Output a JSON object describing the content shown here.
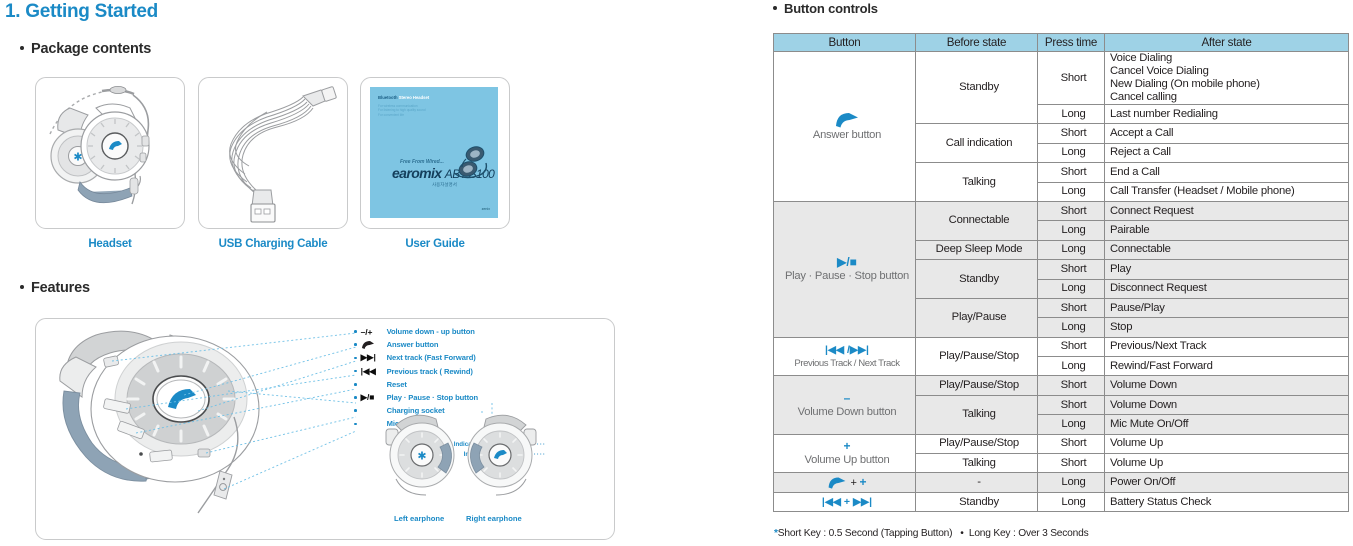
{
  "headings": {
    "chapter": "1. Getting Started",
    "package_contents": "Package contents",
    "features": "Features",
    "button_controls": "Button controls"
  },
  "package": {
    "items": [
      {
        "label": "Headset",
        "image": "headset-illustration"
      },
      {
        "label": "USB Charging Cable",
        "image": "usb-cable-illustration"
      },
      {
        "label": "User Guide",
        "image": "user-guide-cover"
      }
    ],
    "guide_cover": {
      "brand_prefix": "Bluetooth",
      "brand": "Stereo Headset",
      "lines": [
        "For wireless communication",
        "For listening to high quality sound",
        "For convenient life"
      ],
      "tagline": "Free From Wired...",
      "title": "earomix",
      "model": "ABT-S100",
      "subtitle": "사용자설명서",
      "logo": "zenix"
    }
  },
  "features": {
    "callouts": [
      {
        "symbol": "–/+",
        "label": "Volume down - up button"
      },
      {
        "symbol": "phone-icon",
        "label": "Answer button"
      },
      {
        "symbol": "▶▶|",
        "label": "Next track (Fast Forward)"
      },
      {
        "symbol": "|◀◀",
        "label": "Previous track ( Rewind)"
      },
      {
        "symbol": "",
        "label": "Reset"
      },
      {
        "symbol": "▶/■",
        "label": "Play · Pause · Stop button"
      },
      {
        "symbol": "",
        "label": "Charging socket"
      },
      {
        "symbol": "",
        "label": "Microphone"
      }
    ],
    "indicators": [
      "Indicator Lights (BLUE)",
      "Indicator Lights (RED)"
    ],
    "earphone_labels": {
      "left": "Left earphone",
      "right": "Right earphone"
    }
  },
  "table": {
    "columns": [
      "Button",
      "Before state",
      "Press time",
      "After state"
    ],
    "groups": [
      {
        "shaded": false,
        "button": {
          "symbol": "phone-icon",
          "name": "Answer button",
          "name_size": "normal"
        },
        "rows": [
          {
            "before": "Standby",
            "before_span": 2,
            "press": "Short",
            "after": "Voice Dialing\nCancel Voice Dialing\nNew Dialing (On mobile phone)\nCancel calling",
            "after_lines": 4
          },
          {
            "press": "Long",
            "after": "Last number Redialing"
          },
          {
            "before": "Call indication",
            "before_span": 2,
            "press": "Short",
            "after": "Accept a Call"
          },
          {
            "press": "Long",
            "after": "Reject a Call"
          },
          {
            "before": "Talking",
            "before_span": 2,
            "press": "Short",
            "after": "End a Call"
          },
          {
            "press": "Long",
            "after": "Call Transfer (Headset / Mobile phone)"
          }
        ]
      },
      {
        "shaded": true,
        "button": {
          "symbol": "▶/■",
          "name": "Play · Pause · Stop button",
          "name_size": "normal"
        },
        "rows": [
          {
            "before": "Connectable",
            "before_span": 2,
            "press": "Short",
            "after": "Connect Request"
          },
          {
            "press": "Long",
            "after": "Pairable"
          },
          {
            "before": "Deep Sleep Mode",
            "before_span": 1,
            "press": "Long",
            "after": "Connectable"
          },
          {
            "before": "Standby",
            "before_span": 2,
            "press": "Short",
            "after": "Play"
          },
          {
            "press": "Long",
            "after": "Disconnect Request"
          },
          {
            "before": "Play/Pause",
            "before_span": 2,
            "press": "Short",
            "after": "Pause/Play"
          },
          {
            "press": "Long",
            "after": "Stop"
          }
        ]
      },
      {
        "shaded": false,
        "button": {
          "symbol": "|◀◀ /▶▶|",
          "name": "Previous Track / Next Track",
          "name_size": "small"
        },
        "rows": [
          {
            "before": "Play/Pause/Stop",
            "before_span": 2,
            "press": "Short",
            "after": "Previous/Next Track"
          },
          {
            "press": "Long",
            "after": "Rewind/Fast Forward"
          }
        ]
      },
      {
        "shaded": true,
        "button": {
          "symbol": "–",
          "name": "Volume Down button",
          "name_size": "normal"
        },
        "rows": [
          {
            "before": "Play/Pause/Stop",
            "before_span": 1,
            "press": "Short",
            "after": "Volume Down"
          },
          {
            "before": "Talking",
            "before_span": 2,
            "press": "Short",
            "after": "Volume Down"
          },
          {
            "press": "Long",
            "after": "Mic Mute On/Off"
          }
        ]
      },
      {
        "shaded": false,
        "button": {
          "symbol": "+",
          "name": "Volume Up button",
          "name_size": "normal"
        },
        "rows": [
          {
            "before": "Play/Pause/Stop",
            "before_span": 1,
            "press": "Short",
            "after": "Volume Up"
          },
          {
            "before": "Talking",
            "before_span": 1,
            "press": "Short",
            "after": "Volume Up"
          }
        ]
      },
      {
        "shaded": true,
        "button": {
          "symbol": "phone-icon + +",
          "name": "",
          "name_size": "normal"
        },
        "rows": [
          {
            "before": "-",
            "before_span": 1,
            "press": "Long",
            "after": "Power On/Off"
          }
        ]
      },
      {
        "shaded": false,
        "button": {
          "symbol": "|◀◀ + ▶▶|",
          "name": "",
          "name_size": "normal"
        },
        "rows": [
          {
            "before": "Standby",
            "before_span": 1,
            "press": "Long",
            "after": "Battery Status Check"
          }
        ]
      }
    ],
    "footnote": {
      "star": "*",
      "short": "Short Key : 0.5 Second (Tapping Button)",
      "separator": "•",
      "long": "Long Key : Over 3 Seconds"
    }
  },
  "colors": {
    "brand_blue": "#1b8ac6",
    "header_fill": "#9ed2e6",
    "row_shaded": "#e8e8e8",
    "border": "#8c8c8c",
    "gray_text": "#6f7072"
  }
}
